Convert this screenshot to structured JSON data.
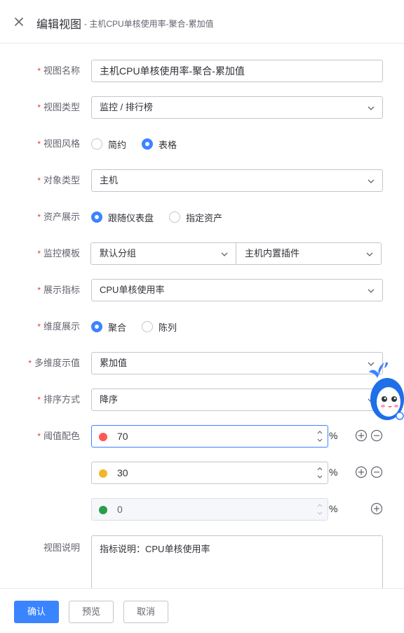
{
  "header": {
    "title": "编辑视图",
    "subtitle": "- 主机CPU单核使用率-聚合-累加值"
  },
  "form": {
    "view_name": {
      "label": "视图名称",
      "value": "主机CPU单核使用率-聚合-累加值"
    },
    "view_type": {
      "label": "视图类型",
      "value": "监控 / 排行榜"
    },
    "view_style": {
      "label": "视图风格",
      "options": [
        "简约",
        "表格"
      ],
      "selected": "表格"
    },
    "object_type": {
      "label": "对象类型",
      "value": "主机"
    },
    "asset_display": {
      "label": "资产展示",
      "options": [
        "跟随仪表盘",
        "指定资产"
      ],
      "selected": "跟随仪表盘"
    },
    "monitor_template": {
      "label": "监控模板",
      "group": "默认分组",
      "plugin": "主机内置插件"
    },
    "display_metric": {
      "label": "展示指标",
      "value": "CPU单核使用率"
    },
    "dimension_display": {
      "label": "维度展示",
      "options": [
        "聚合",
        "陈列"
      ],
      "selected": "聚合"
    },
    "multi_dim_value": {
      "label": "多维度示值",
      "value": "累加值"
    },
    "sort_order": {
      "label": "排序方式",
      "value": "降序"
    },
    "threshold": {
      "label": "阈值配色",
      "unit": "%",
      "items": [
        {
          "value": "70",
          "color": "#ff5656"
        },
        {
          "value": "30",
          "color": "#ffb848"
        },
        {
          "value": "0",
          "color": "#2dcb56"
        }
      ]
    },
    "description": {
      "label": "视图说明",
      "value": "指标说明：CPU单核使用率"
    }
  },
  "footer": {
    "confirm": "确认",
    "preview": "预览",
    "cancel": "取消"
  },
  "colors": {
    "primary": "#3a84ff",
    "required": "#ea3636",
    "border": "#c4c6cc"
  }
}
